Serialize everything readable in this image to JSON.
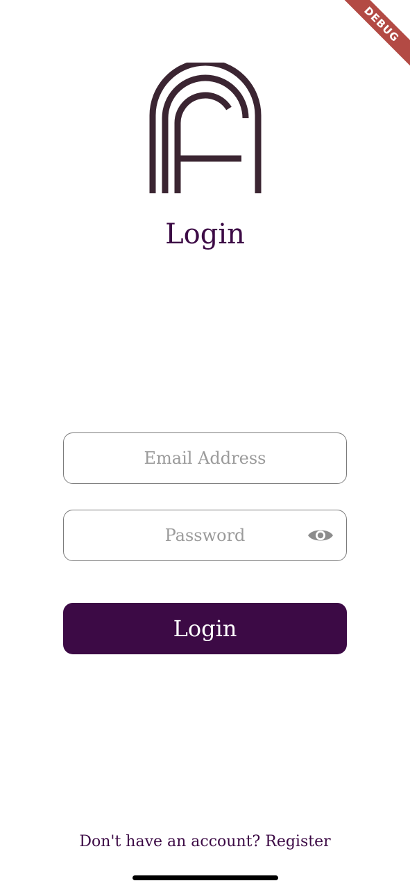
{
  "debug_banner": "DEBUG",
  "logo": {
    "icon": "arch-f-logo",
    "color": "#3b2532"
  },
  "page": {
    "title": "Login"
  },
  "email": {
    "placeholder": "Email Address",
    "value": ""
  },
  "password": {
    "placeholder": "Password",
    "value": "",
    "toggle_icon": "eye-icon"
  },
  "login_button": {
    "label": "Login"
  },
  "footer": {
    "prompt": "Don't have an account?",
    "link": "Register"
  },
  "colors": {
    "primary": "#3c0a45",
    "border": "#7c7c7c",
    "placeholder": "#9b9b9b",
    "debug_ribbon": "#b34a44"
  }
}
